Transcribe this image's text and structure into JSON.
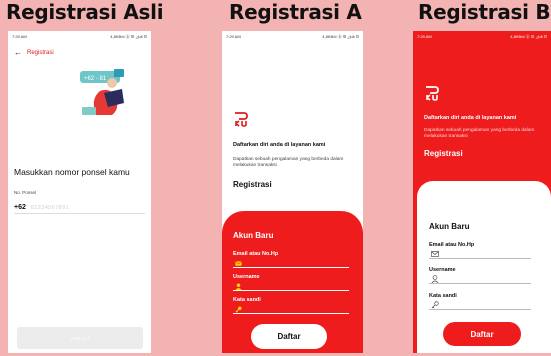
{
  "headings": {
    "asli": "Registrasi Asli",
    "a": "Registrasi A",
    "b": "Registrasi B"
  },
  "status": {
    "time": "7:29 AM",
    "icons": "4,8KB/d ⓑ ☰ ◿ull ⊡"
  },
  "asli": {
    "back_title": "Registrasi",
    "prompt": "Masukkan nomor ponsel kamu",
    "phone_label": "No. Ponsel",
    "prefix": "+62",
    "placeholder": "81234567891",
    "button": "LANJUT",
    "illustration_text": "+62 - 81"
  },
  "a": {
    "subtitle": "Daftarkan diri anda di layanan kami",
    "desc": "Dapatkan sebuah pengalaman yang berbeda dalam melakukan transaksi",
    "title": "Registrasi",
    "section": "Akun Baru",
    "fields": [
      {
        "label": "Email atau No.Hp",
        "icon": "email-icon"
      },
      {
        "label": "Username",
        "icon": "user-icon"
      },
      {
        "label": "Kata sandi",
        "icon": "key-icon"
      }
    ],
    "button": "Daftar"
  },
  "b": {
    "subtitle": "Daftarkan diri anda di layanan kami",
    "desc": "Dapatkan sebuah pengalaman yang berbeda dalam melakukan transaksi",
    "title": "Registrasi",
    "section": "Akun Baru",
    "fields": [
      {
        "label": "Email atau No.Hp",
        "icon": "email-icon"
      },
      {
        "label": "Username",
        "icon": "user-icon"
      },
      {
        "label": "Kata sandi",
        "icon": "key-icon"
      }
    ],
    "button": "Daftar"
  },
  "colors": {
    "brand_red": "#ee1c1c",
    "background": "#f4b3b3"
  }
}
